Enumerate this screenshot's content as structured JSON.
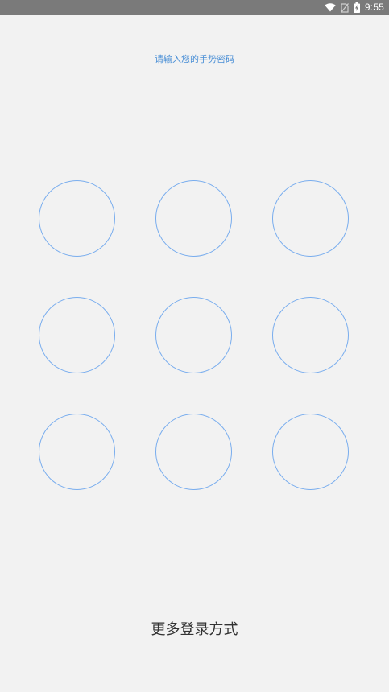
{
  "status_bar": {
    "time": "9:55",
    "icons": [
      "wifi-icon",
      "no-sim-icon",
      "battery-charging-icon"
    ]
  },
  "gesture": {
    "prompt": "请输入您的手势密码",
    "dots": [
      1,
      2,
      3,
      4,
      5,
      6,
      7,
      8,
      9
    ],
    "accent_color": "#79adee",
    "prompt_color": "#4a8fd6"
  },
  "footer": {
    "more_login_label": "更多登录方式"
  }
}
